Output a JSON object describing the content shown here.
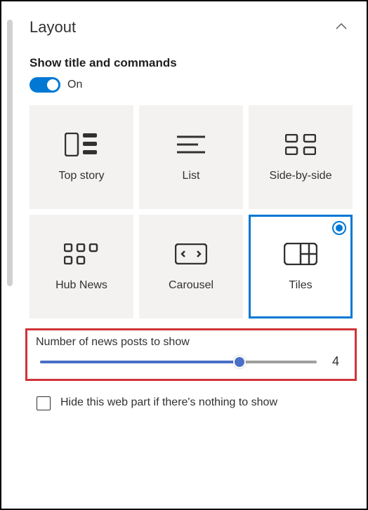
{
  "section": {
    "title": "Layout"
  },
  "toggle": {
    "label": "Show title and commands",
    "state": "On"
  },
  "layouts": {
    "topStory": "Top story",
    "list": "List",
    "sideBySide": "Side-by-side",
    "hubNews": "Hub News",
    "carousel": "Carousel",
    "tiles": "Tiles"
  },
  "slider": {
    "label": "Number of news posts to show",
    "value": "4"
  },
  "hideCheckbox": {
    "label": "Hide this web part if there's nothing to show"
  }
}
